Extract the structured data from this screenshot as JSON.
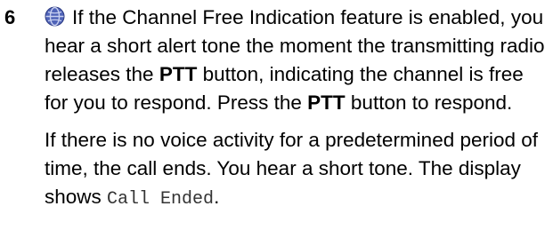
{
  "step": {
    "number": "6",
    "icon": "globe-feature-icon",
    "para1": {
      "text_1": "If the Channel Free Indication feature is enabled, you hear a short alert tone the moment the transmitting radio releases the ",
      "bold_1": "PTT",
      "text_2": " button, indicating the channel is free for you to respond. Press the ",
      "bold_2": "PTT",
      "text_3": " button to respond."
    },
    "para2": {
      "text_1": "If there is no voice activity for a predetermined period of time, the call ends. You hear a short tone. The display shows ",
      "display_text": "Call Ended",
      "text_2": "."
    }
  },
  "colors": {
    "icon_fill": "#4f63b8",
    "icon_highlight": "#c8d0f0",
    "text": "#000000"
  }
}
